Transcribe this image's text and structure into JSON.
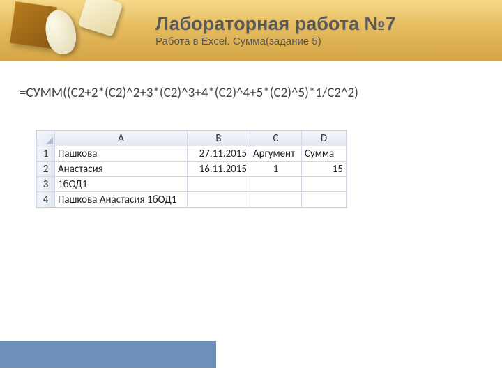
{
  "title": "Лабораторная работа №7",
  "subtitle": "Работа в Excel. Сумма(задание 5)",
  "formula": "=СУММ((C2+2*(C2)^2+3*(C2)^3+4*(C2)^4+5*(C2)^5)*1/C2^2)",
  "columns": [
    "A",
    "B",
    "C",
    "D"
  ],
  "rows": [
    {
      "n": "1",
      "A": "Пашкова",
      "B": "27.11.2015",
      "C": "Аргумент",
      "D": "Сумма"
    },
    {
      "n": "2",
      "A": "Анастасия",
      "B": "16.11.2015",
      "C": "1",
      "D": "15"
    },
    {
      "n": "3",
      "A": "1бОД1",
      "B": "",
      "C": "",
      "D": ""
    },
    {
      "n": "4",
      "A": "Пашкова Анастасия 1бОД1",
      "B": "",
      "C": "",
      "D": ""
    }
  ]
}
